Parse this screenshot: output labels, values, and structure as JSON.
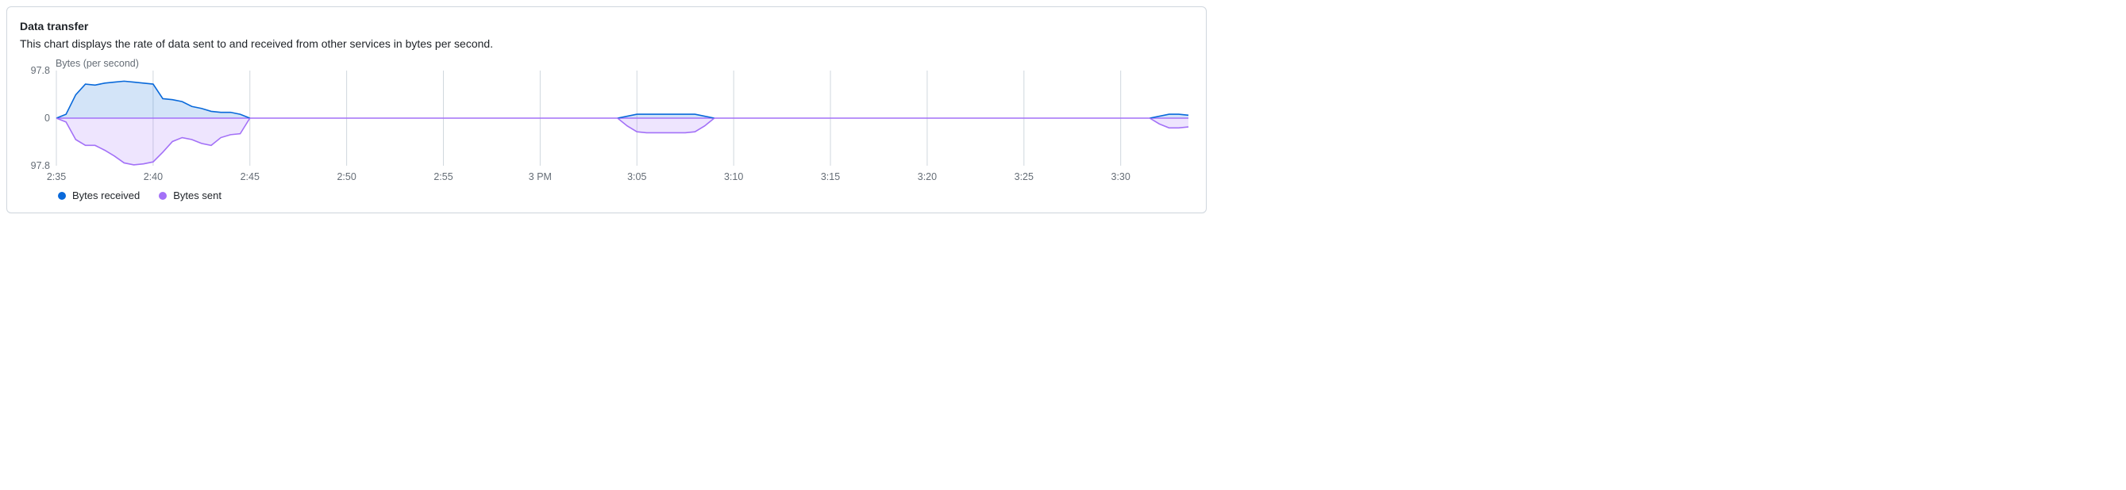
{
  "title": "Data transfer",
  "description": "This chart displays the rate of data sent to and received from other services in bytes per second.",
  "ylabel": "Bytes (per second)",
  "legend": {
    "received": {
      "label": "Bytes received",
      "color": "#0969da"
    },
    "sent": {
      "label": "Bytes sent",
      "color": "#a371f7"
    }
  },
  "yticks": {
    "top": "97.8",
    "mid": "0",
    "bot": "97.8"
  },
  "xticks": [
    "2:35",
    "2:40",
    "2:45",
    "2:50",
    "2:55",
    "3 PM",
    "3:05",
    "3:10",
    "3:15",
    "3:20",
    "3:25",
    "3:30"
  ],
  "chart_data": {
    "type": "area",
    "title": "Data transfer",
    "ylabel": "Bytes (per second)",
    "xlabel": "",
    "x_range_minutes": [
      155,
      213.5
    ],
    "ylim_received": [
      0,
      97.8
    ],
    "ylim_sent": [
      0,
      97.8
    ],
    "x": [
      155,
      155.5,
      156,
      156.5,
      157,
      157.5,
      158,
      158.5,
      159,
      159.5,
      160,
      160.5,
      161,
      161.5,
      162,
      162.5,
      163,
      163.5,
      164,
      164.5,
      165,
      184,
      184.5,
      185,
      185.5,
      186,
      186.5,
      187,
      187.5,
      188,
      188.5,
      189,
      211.5,
      212,
      212.5,
      213,
      213.5
    ],
    "series": [
      {
        "name": "Bytes received",
        "color": "#0969da",
        "values": [
          0,
          8,
          48,
          70,
          68,
          72,
          74,
          76,
          74,
          72,
          70,
          40,
          38,
          34,
          24,
          20,
          14,
          12,
          12,
          8,
          0,
          0,
          4,
          8,
          8,
          8,
          8,
          8,
          8,
          8,
          4,
          0,
          0,
          4,
          8,
          8,
          6
        ]
      },
      {
        "name": "Bytes sent",
        "color": "#a371f7",
        "values": [
          0,
          8,
          44,
          56,
          56,
          66,
          78,
          92,
          96,
          94,
          90,
          70,
          48,
          40,
          44,
          52,
          56,
          40,
          34,
          32,
          0,
          0,
          16,
          28,
          30,
          30,
          30,
          30,
          30,
          28,
          16,
          0,
          0,
          12,
          20,
          20,
          18
        ]
      }
    ]
  }
}
